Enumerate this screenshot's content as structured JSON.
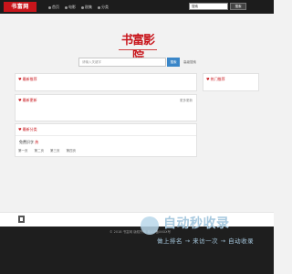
{
  "header": {
    "logo": "书富网",
    "nav": [
      {
        "label": "首页"
      },
      {
        "label": "电影"
      },
      {
        "label": "剧集"
      },
      {
        "label": "分类"
      }
    ],
    "search_placeholder": "搜索",
    "search_button": "搜索"
  },
  "hero": {
    "logo_text": "书富影院",
    "search_placeholder": "请输入关键字",
    "search_button": "搜索",
    "advanced_link": "高级搜索"
  },
  "panels": {
    "recommend": {
      "title": "最新推荐"
    },
    "hot": {
      "title": "热门推荐"
    },
    "latest": {
      "title": "最新更新",
      "more": "更多更新"
    },
    "category": {
      "title": "最新分类",
      "item_text": "免费识字",
      "item_badge": "热",
      "pages": [
        "第一页",
        "第二页",
        "第三页",
        "第四页"
      ]
    }
  },
  "footer": {
    "copyright": "© 2018 书富网 版权所有 粤ICP备XXXX号"
  },
  "watermark": {
    "title": "自动秒收录",
    "subtitle": "做上排名 → 来访一次 → 自动收录"
  }
}
